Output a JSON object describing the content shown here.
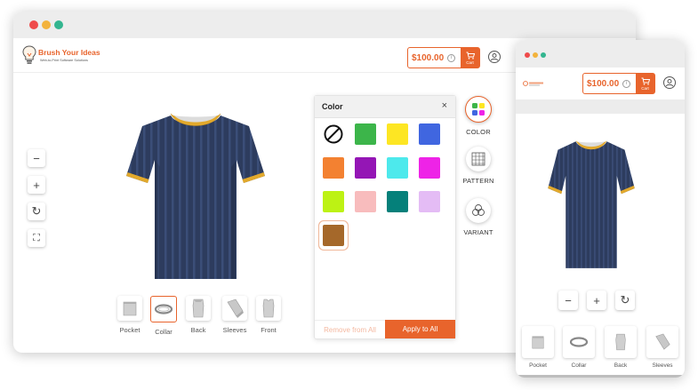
{
  "desktop": {
    "brand": "Brush Your Ideas",
    "tagline": "Web-to-Print Software Solutions",
    "price": "$100.00",
    "cart_label": "Cart",
    "zoom_controls": [
      {
        "name": "zoom-out-button",
        "icon": "minus-icon",
        "glyph": "−"
      },
      {
        "name": "zoom-in-button",
        "icon": "plus-icon",
        "glyph": "+"
      },
      {
        "name": "rotate-button",
        "icon": "refresh-icon",
        "glyph": "↻"
      },
      {
        "name": "fullscreen-button",
        "icon": "fullscreen-icon",
        "glyph": "⛶"
      }
    ],
    "parts": [
      {
        "label": "Pocket",
        "icon": "pocket-icon"
      },
      {
        "label": "Collar",
        "icon": "collar-icon",
        "selected": true
      },
      {
        "label": "Back",
        "icon": "back-icon"
      },
      {
        "label": "Sleeves",
        "icon": "sleeves-icon"
      },
      {
        "label": "Front",
        "icon": "front-icon"
      }
    ],
    "color_panel": {
      "title": "Color",
      "close": "×",
      "swatches": [
        "none",
        "#3cb54a",
        "#fde623",
        "#4066e0",
        "#f38131",
        "#9416b5",
        "#4de9ec",
        "#ee23e7",
        "#bdf214",
        "#f8bcbd",
        "#05807a",
        "#e4bcf5",
        "#a5682a"
      ],
      "selected_swatch": "#a5682a",
      "remove_label": "Remove from All",
      "apply_label": "Apply to All"
    },
    "tools": [
      {
        "label": "COLOR",
        "icon": "color-palette-icon",
        "selected": true
      },
      {
        "label": "PATTERN",
        "icon": "pattern-icon"
      },
      {
        "label": "VARIANT",
        "icon": "variant-icon"
      }
    ]
  },
  "mobile": {
    "price": "$100.00",
    "cart_label": "Cart",
    "controls": [
      {
        "name": "zoom-out-button",
        "icon": "minus-icon",
        "glyph": "−"
      },
      {
        "name": "zoom-in-button",
        "icon": "plus-icon",
        "glyph": "+"
      },
      {
        "name": "rotate-button",
        "icon": "refresh-icon",
        "glyph": "↻"
      }
    ],
    "parts": [
      {
        "label": "Pocket",
        "icon": "pocket-icon"
      },
      {
        "label": "Collar",
        "icon": "collar-icon"
      },
      {
        "label": "Back",
        "icon": "back-icon"
      },
      {
        "label": "Sleeves",
        "icon": "sleeves-icon"
      }
    ]
  },
  "colors": {
    "accent": "#e8642c",
    "shirt": "#2d3c5e",
    "trim": "#e2a92c"
  }
}
